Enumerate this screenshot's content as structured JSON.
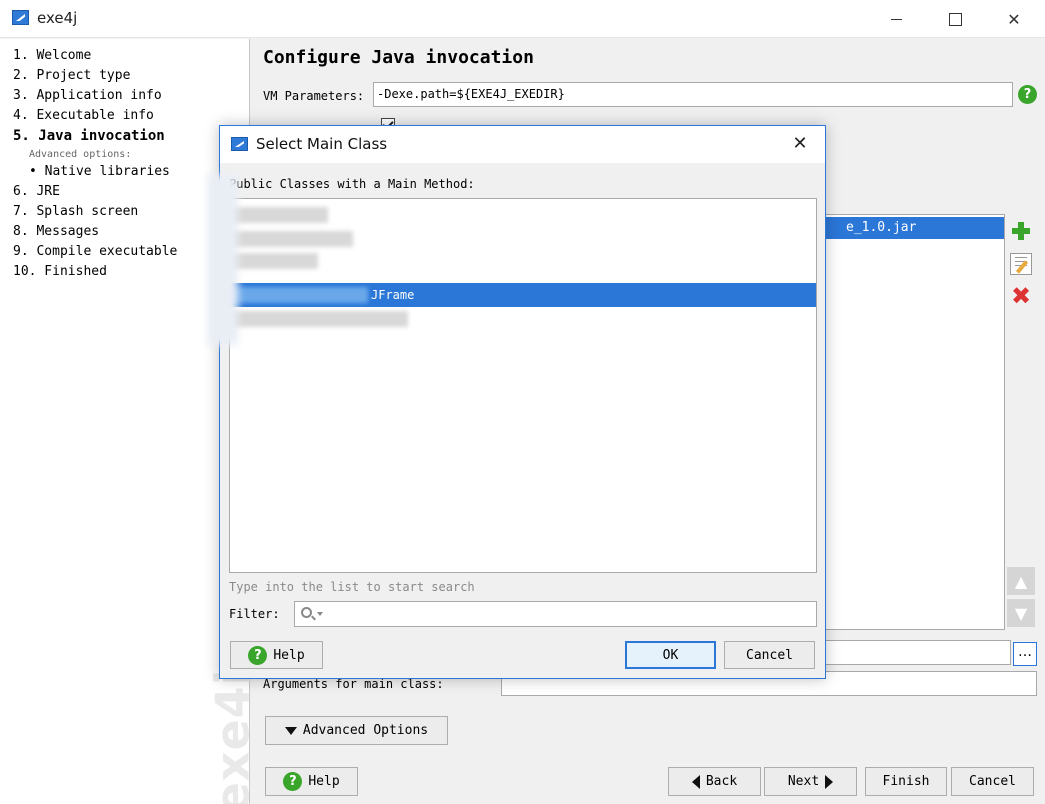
{
  "window": {
    "title": "exe4j"
  },
  "sidebar": {
    "steps": [
      {
        "label": "1. Welcome",
        "active": false,
        "kind": "step"
      },
      {
        "label": "2. Project type",
        "active": false,
        "kind": "step"
      },
      {
        "label": "3. Application info",
        "active": false,
        "kind": "step"
      },
      {
        "label": "4. Executable info",
        "active": false,
        "kind": "step"
      },
      {
        "label": "5. Java invocation",
        "active": true,
        "kind": "step"
      },
      {
        "label": "Advanced options:",
        "active": false,
        "kind": "sub-heading"
      },
      {
        "label": "• Native libraries",
        "active": false,
        "kind": "sub"
      },
      {
        "label": "6. JRE",
        "active": false,
        "kind": "step"
      },
      {
        "label": "7. Splash screen",
        "active": false,
        "kind": "step"
      },
      {
        "label": "8. Messages",
        "active": false,
        "kind": "step"
      },
      {
        "label": "9. Compile executable",
        "active": false,
        "kind": "step"
      },
      {
        "label": "10. Finished",
        "active": false,
        "kind": "step"
      }
    ],
    "brand": "exe4j"
  },
  "main": {
    "title": "Configure Java invocation",
    "vm_label": "VM Parameters:",
    "vm_value": "-Dexe.path=${EXE4J_EXEDIR}",
    "classpath_entry": "e_1.0.jar",
    "args_label": "Arguments for main class:",
    "args_value": "",
    "help_label": "Help",
    "advanced_label": "Advanced Options",
    "back_label": "Back",
    "next_label": "Next",
    "finish_label": "Finish",
    "cancel_label": "Cancel"
  },
  "dialog": {
    "title": "Select Main Class",
    "list_label": "Public Classes with a Main Method:",
    "selected_class": "JFrame",
    "hint": "Type into the list to start search",
    "filter_label": "Filter:",
    "filter_value": "",
    "help_label": "Help",
    "ok_label": "OK",
    "cancel_label": "Cancel"
  },
  "colors": {
    "selection": "#2b77d8",
    "help_green": "#3aa52b",
    "delete_red": "#d33333"
  }
}
